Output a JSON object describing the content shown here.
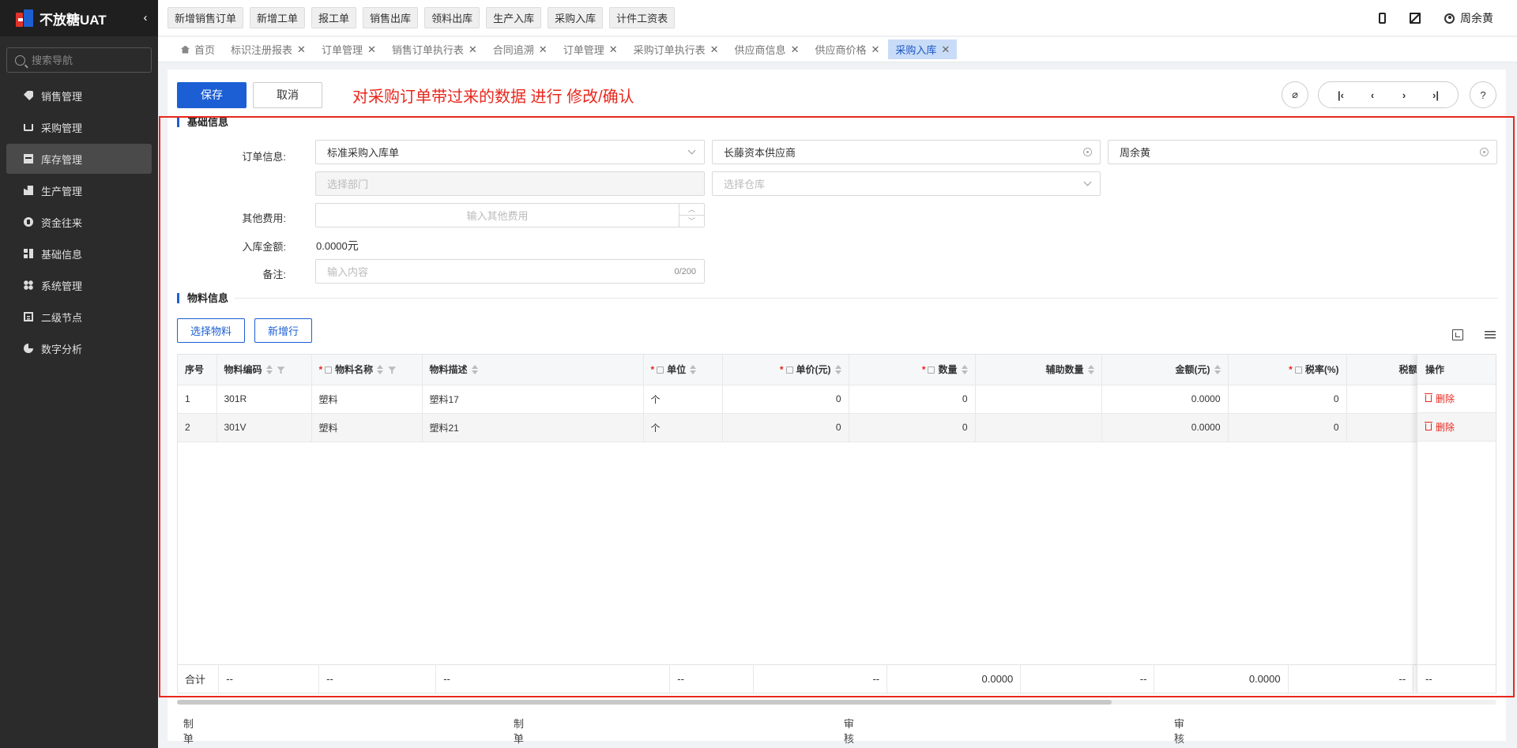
{
  "app": {
    "title": "不放糖UAT"
  },
  "sidebar": {
    "search_placeholder": "搜索导航",
    "items": [
      {
        "label": "销售管理",
        "icon": "tag-icon"
      },
      {
        "label": "采购管理",
        "icon": "cart-icon"
      },
      {
        "label": "库存管理",
        "icon": "inventory-icon",
        "active": true
      },
      {
        "label": "生产管理",
        "icon": "factory-icon"
      },
      {
        "label": "资金往来",
        "icon": "coin-icon"
      },
      {
        "label": "基础信息",
        "icon": "grid-icon"
      },
      {
        "label": "系统管理",
        "icon": "apps-icon"
      },
      {
        "label": "二级节点",
        "icon": "doc-icon"
      },
      {
        "label": "数字分析",
        "icon": "pie-chart-icon"
      }
    ]
  },
  "topbar": {
    "quick_actions": [
      "新增销售订单",
      "新增工单",
      "报工单",
      "销售出库",
      "领料出库",
      "生产入库",
      "采购入库",
      "计件工资表"
    ],
    "user_name": "周余黄"
  },
  "tabs": [
    {
      "label": "首页",
      "closable": false
    },
    {
      "label": "标识注册报表",
      "closable": true
    },
    {
      "label": "订单管理",
      "closable": true
    },
    {
      "label": "销售订单执行表",
      "closable": true
    },
    {
      "label": "合同追溯",
      "closable": true
    },
    {
      "label": "订单管理",
      "closable": true
    },
    {
      "label": "采购订单执行表",
      "closable": true
    },
    {
      "label": "供应商信息",
      "closable": true
    },
    {
      "label": "供应商价格",
      "closable": true
    },
    {
      "label": "采购入库",
      "closable": true,
      "active": true
    }
  ],
  "toolbar": {
    "save_label": "保存",
    "cancel_label": "取消",
    "annotation": "对采购订单带过来的数据 进行 修改/确认",
    "help_label": "?"
  },
  "basic_info": {
    "title": "基础信息",
    "order_label": "订单信息:",
    "order_type": "标准采购入库单",
    "supplier": "长藤资本供应商",
    "owner": "周余黄",
    "department_placeholder": "选择部门",
    "warehouse_placeholder": "选择仓库",
    "other_fee_label": "其他费用:",
    "other_fee_placeholder": "输入其他费用",
    "amount_label": "入库金额:",
    "amount_value": "0.0000",
    "amount_unit": "元",
    "remark_label": "备注:",
    "remark_placeholder": "输入内容",
    "remark_counter": "0/200"
  },
  "material_info": {
    "title": "物料信息",
    "select_material_label": "选择物料",
    "add_row_label": "新增行"
  },
  "table": {
    "columns": {
      "index": "序号",
      "code": "物料编码",
      "name": "物料名称",
      "desc": "物料描述",
      "unit": "单位",
      "price": "单价(元)",
      "qty": "数量",
      "aux_qty": "辅助数量",
      "amount": "金额(元)",
      "tax_rate": "税率(%)",
      "tax_more": "税额",
      "action": "操作"
    },
    "rows": [
      {
        "index": "1",
        "code": "301R",
        "name": "塑料",
        "desc": "塑料17",
        "unit": "个",
        "price": "0",
        "qty": "0",
        "aux_qty": "",
        "amount": "0.0000",
        "tax_rate": "0",
        "tax_more": ""
      },
      {
        "index": "2",
        "code": "301V",
        "name": "塑料",
        "desc": "塑料21",
        "unit": "个",
        "price": "0",
        "qty": "0",
        "aux_qty": "",
        "amount": "0.0000",
        "tax_rate": "0",
        "tax_more": ""
      }
    ],
    "delete_label": "删除",
    "summary": {
      "label": "合计",
      "code": "--",
      "name": "--",
      "desc": "--",
      "unit": "--",
      "price": "--",
      "qty": "0.0000",
      "aux_qty": "--",
      "amount": "0.0000",
      "tax_rate": "--",
      "tax_more": "",
      "action": "--"
    }
  },
  "footer": {
    "creator_label": "制单人:",
    "creator": "--",
    "created_date_label": "制单日期:",
    "created_date": "--",
    "reviewer_label": "审核人:",
    "reviewer": "--",
    "review_date_label": "审核日期:",
    "review_date": "--"
  },
  "colors": {
    "primary": "#1c5fd4",
    "annotation": "#e8271d",
    "sidebar_bg": "#2b2b2b"
  }
}
